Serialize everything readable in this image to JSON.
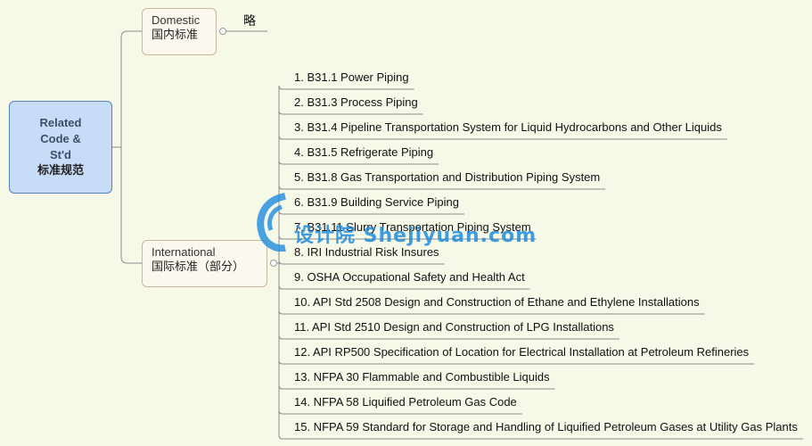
{
  "root": {
    "line1": "Related",
    "line2": "Code &",
    "line3": "St'd",
    "line4": "标准规范"
  },
  "domestic": {
    "en": "Domestic",
    "cn": "国内标准",
    "note": "略"
  },
  "international": {
    "en": "International",
    "cn": "国际标准（部分）"
  },
  "items": [
    "1. B31.1 Power Piping",
    "2. B31.3 Process Piping",
    "3. B31.4 Pipeline Transportation System for Liquid Hydrocarbons and Other Liquids",
    "4. B31.5 Refrigerate Piping",
    "5. B31.8 Gas Transportation and Distribution Piping System",
    "6. B31.9 Building Service Piping",
    "7. B31.11 Slurry Transportation Piping System",
    "8. IRI Industrial Risk Insures",
    "9. OSHA Occupational Safety and Health Act",
    "10. API Std 2508 Design and Construction of Ethane and Ethylene Installations",
    "11. API Std 2510 Design and Construction of LPG Installations",
    "12. API RP500 Specification of Location for Electrical Installation at Petroleum Refineries",
    "13. NFPA 30 Flammable and Combustible Liquids",
    "14. NFPA 58 Liquified Petroleum Gas Code",
    "15. NFPA 59 Standard for Storage and Handling of Liquified Petroleum Gases at Utility Gas Plants"
  ],
  "watermark": {
    "text": "设计院 Shejiyuan.com"
  },
  "colors": {
    "background": "#f6f8e8",
    "root_fill": "#c7ddf7",
    "root_border": "#5a82bf",
    "branch_border": "#c9b89b",
    "line": "#8c8c8c"
  }
}
